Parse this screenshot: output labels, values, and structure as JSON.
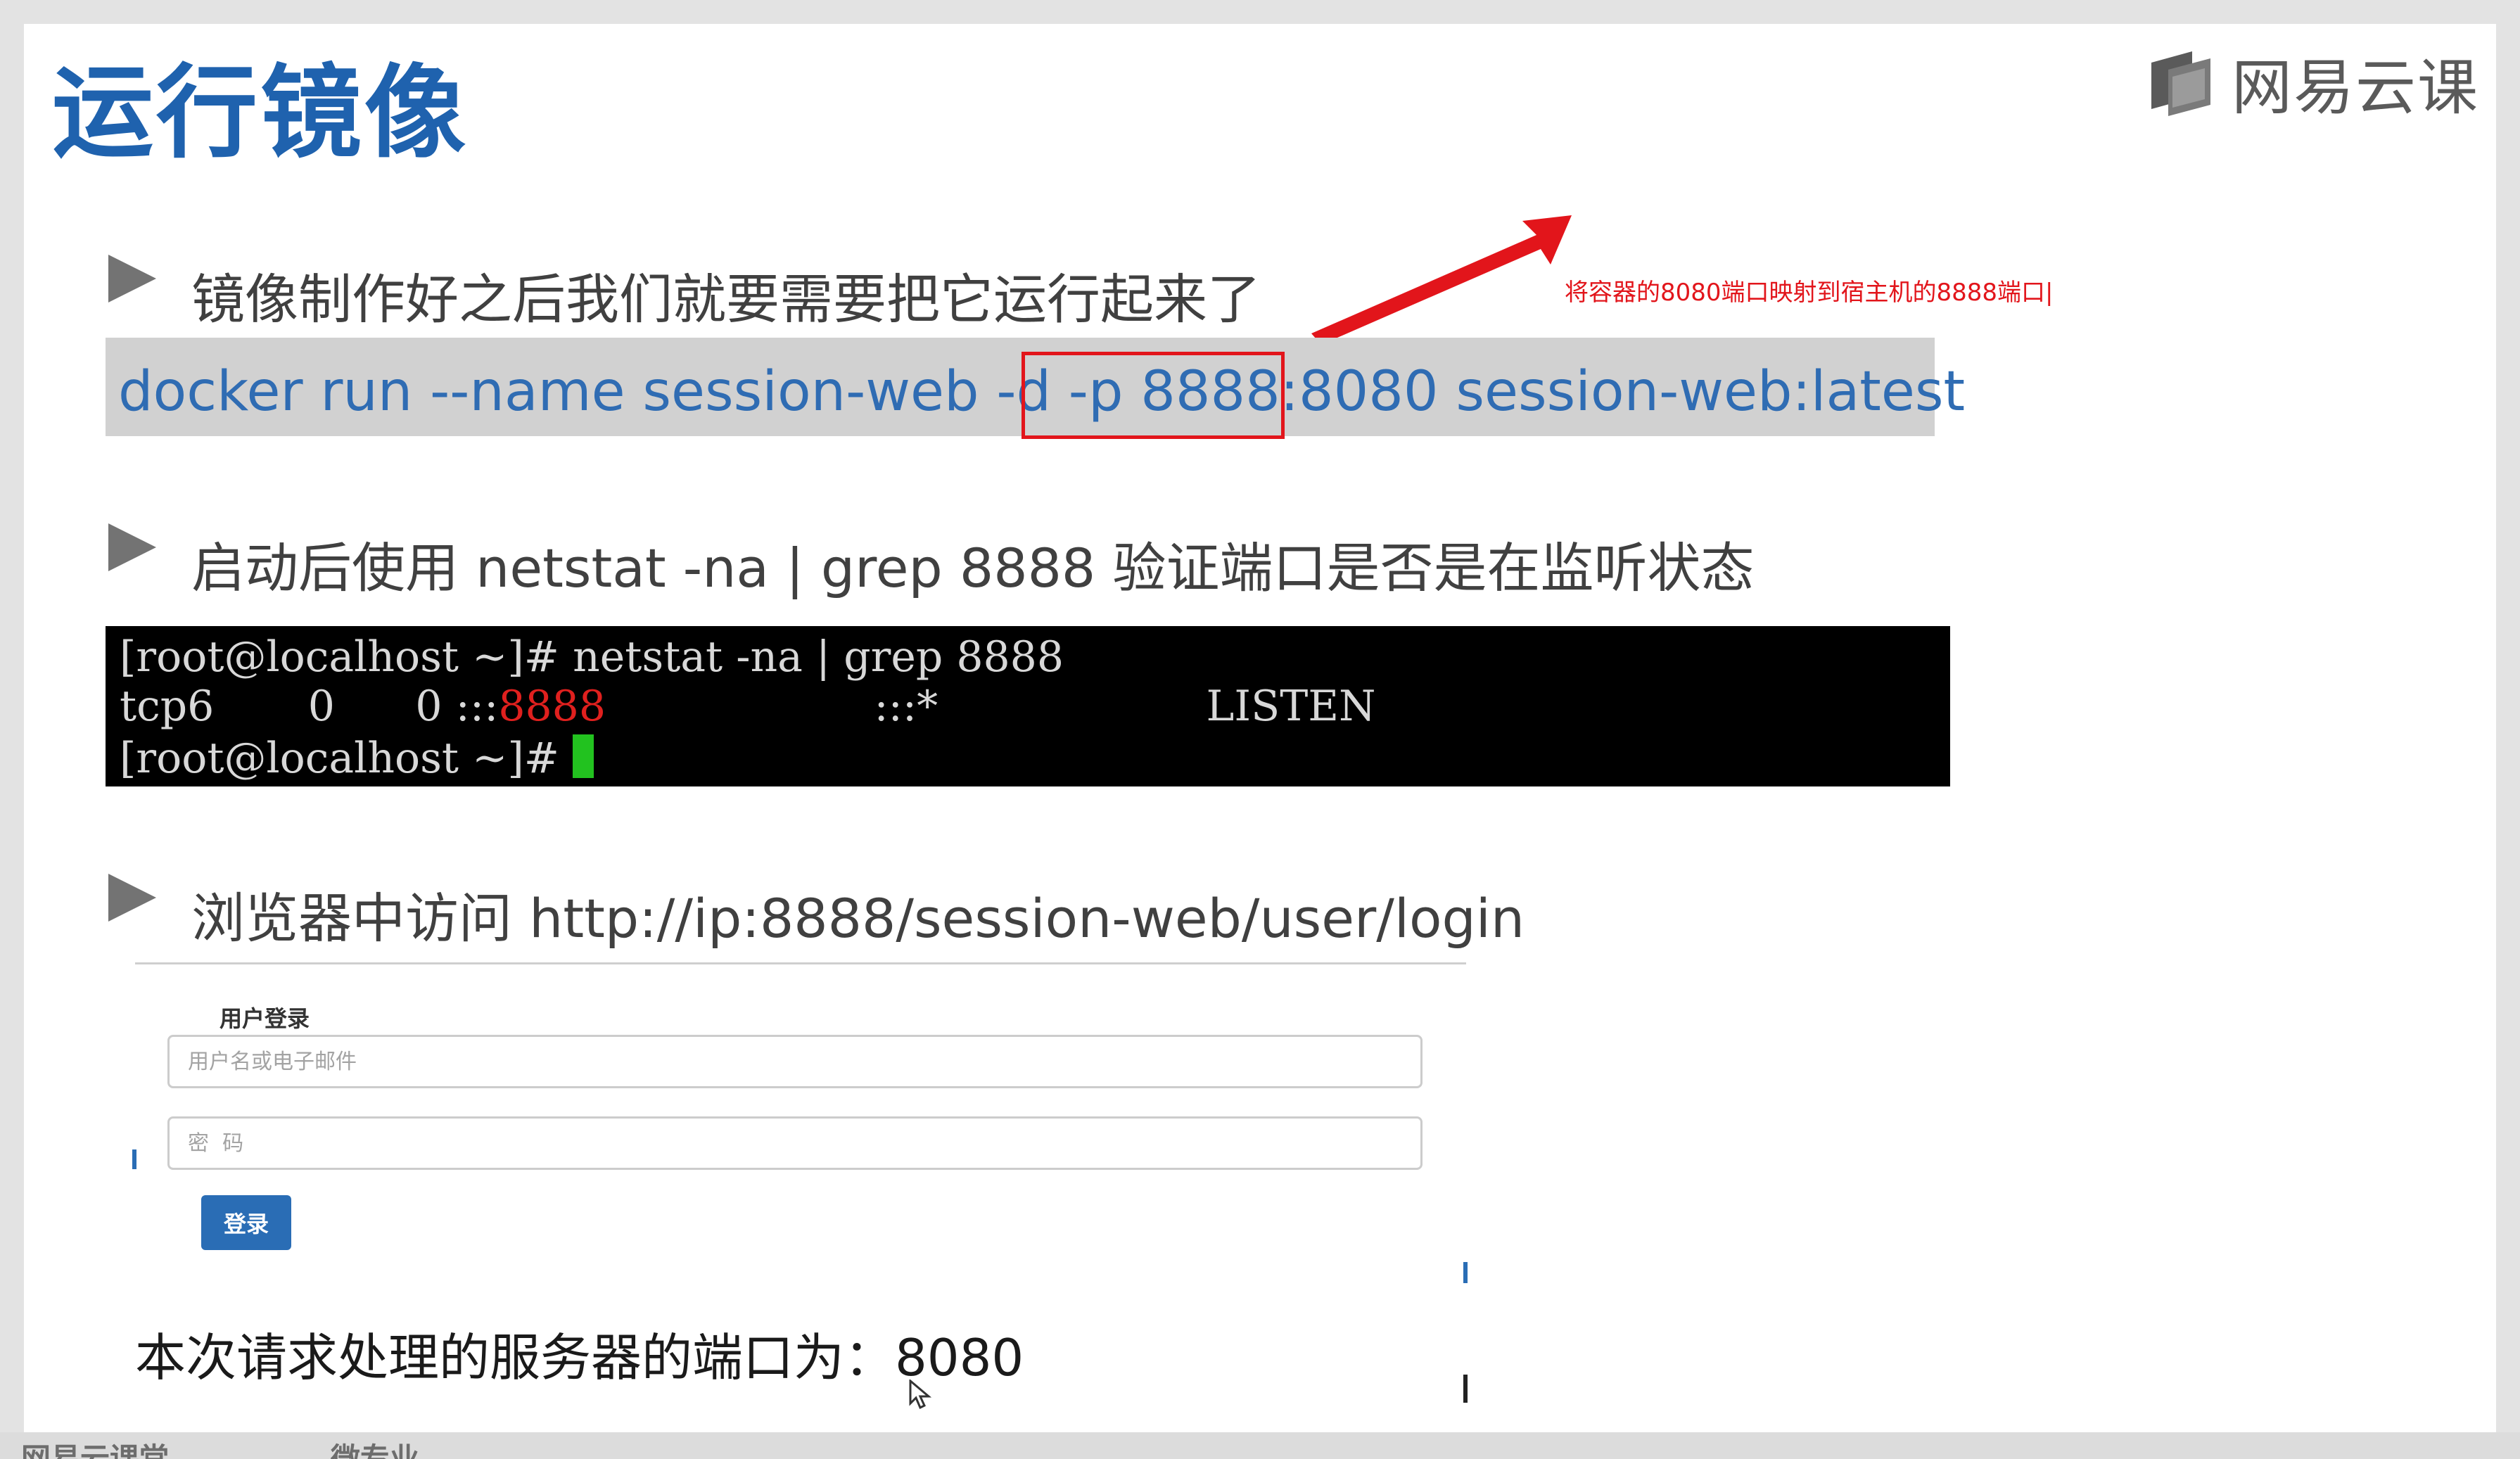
{
  "slide": {
    "title": "运行镜像",
    "logo_text": "网易云课",
    "logo_icon": "netease-cloud-classroom-icon",
    "bullet_icon": "triangle-right-icon"
  },
  "section1": {
    "text": "镜像制作好之后我们就要需要把它运行起来了",
    "cmd_prefix": "docker run --name session-web -d -p ",
    "cmd_port": "8888:8080",
    "cmd_suffix": " session-web:latest",
    "annotation": "将容器的8080端口映射到宿主机的8888端口|"
  },
  "section2": {
    "text": "启动后使用 netstat -na | grep 8888 验证端口是否是在监听状态",
    "terminal": {
      "line1": "[root@localhost ~]# netstat -na | grep 8888",
      "line2_pre": "tcp6       0      0 :::",
      "line2_port": "8888",
      "line2_post": "                    :::*                    LISTEN",
      "line3": "[root@localhost ~]# "
    }
  },
  "section3": {
    "text": "浏览器中访问 http://ip:8888/session-web/user/login",
    "login": {
      "title": "用户登录",
      "username_placeholder": "用户名或电子邮件",
      "password_placeholder": "密  码",
      "submit_label": "登录"
    },
    "server_port_text": "本次请求处理的服务器的端口为：8080"
  },
  "footer": {
    "left": "网易云课堂",
    "right": "微专业"
  },
  "colors": {
    "title": "#1f62ae",
    "command": "#2f6cb3",
    "highlight": "#e2151b",
    "terminal_bg": "#000000",
    "cursor": "#22c21f",
    "button": "#2a6db5"
  }
}
